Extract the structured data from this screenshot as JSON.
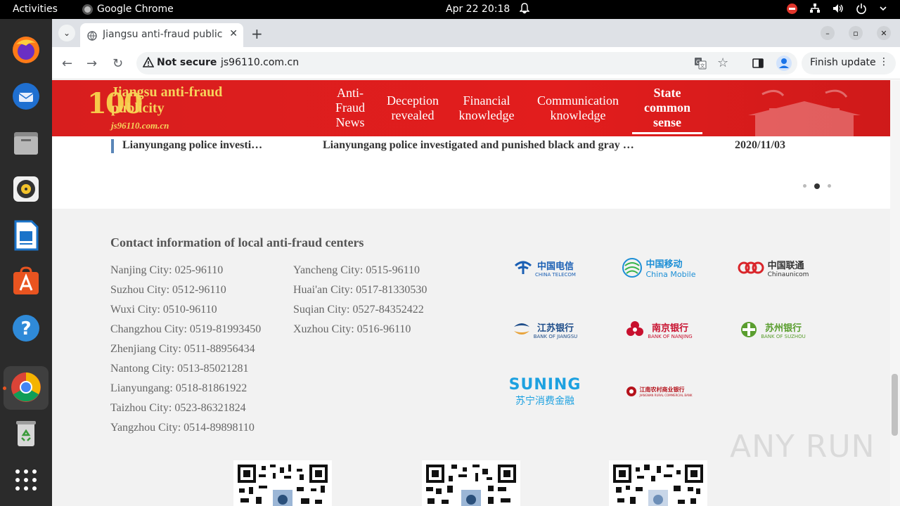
{
  "system": {
    "activities": "Activities",
    "app_name": "Google Chrome",
    "clock": "Apr 22  20:18"
  },
  "browser": {
    "tab_title": "Jiangsu anti-fraud publicity",
    "security_label": "Not secure",
    "url": "js96110.com.cn",
    "update_button": "Finish update"
  },
  "site": {
    "logo_number": "100",
    "logo_title": "Jiangsu anti-fraud publicity",
    "logo_url": "js96110.com.cn",
    "nav": [
      {
        "label": "Anti-\nFraud\nNews",
        "active": false
      },
      {
        "label": "Deception\nrevealed",
        "active": false
      },
      {
        "label": "Financial\nknowledge",
        "active": false
      },
      {
        "label": "Communication\nknowledge",
        "active": false
      },
      {
        "label": "State\ncommon\nsense",
        "active": true
      }
    ],
    "news": {
      "short_title": "Lianyungang police investi…",
      "long_title": "Lianyungang police investigated and punished black and gray …",
      "date": "2020/11/03"
    },
    "pager_active": 2,
    "footer": {
      "contact_title": "Contact information of local anti-fraud centers",
      "contacts_col1": [
        "Nanjing City: 025-96110",
        "Suzhou City: 0512-96110",
        "Wuxi City: 0510-96110",
        "Changzhou City: 0519-81993450",
        "Zhenjiang City: 0511-88956434",
        "Nantong City: 0513-85021281",
        "Lianyungang: 0518-81861922",
        "Taizhou City: 0523-86321824",
        "Yangzhou City: 0514-89898110"
      ],
      "contacts_col2": [
        "Yancheng City: 0515-96110",
        "Huai'an City: 0517-81330530",
        "Suqian City: 0527-84352422",
        "Xuzhou City: 0516-96110"
      ],
      "partners": [
        {
          "name": "中国电信",
          "sub": "CHINA TELECOM",
          "color": "#1a5fb4"
        },
        {
          "name": "中国移动",
          "sub": "China Mobile",
          "color": "#1c8fd6"
        },
        {
          "name": "中国联通",
          "sub": "Chinaunicom",
          "color": "#333333",
          "icon_color": "#d9252a"
        },
        {
          "name": "江苏银行",
          "sub": "BANK OF JIANGSU",
          "color": "#1f4e8a"
        },
        {
          "name": "南京银行",
          "sub": "BANK OF NANJING",
          "color": "#c8102e"
        },
        {
          "name": "苏州银行",
          "sub": "BANK OF SUZHOU",
          "color": "#5a9e2f"
        },
        {
          "name": "SUNING",
          "sub": "苏宁消费金融",
          "color": "#1da1e0"
        },
        {
          "name": "江南农村商业银行",
          "sub": "JIANGNAN RURAL COMMERCIAL BANK",
          "color": "#b5121b"
        }
      ]
    }
  },
  "watermark": "ANY RUN"
}
